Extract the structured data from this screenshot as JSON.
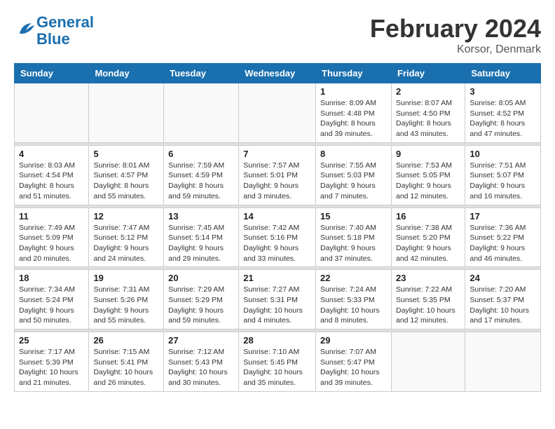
{
  "app": {
    "name": "GeneralBlue",
    "logo_text_part1": "General",
    "logo_text_part2": "Blue"
  },
  "header": {
    "month": "February 2024",
    "location": "Korsor, Denmark"
  },
  "weekdays": [
    "Sunday",
    "Monday",
    "Tuesday",
    "Wednesday",
    "Thursday",
    "Friday",
    "Saturday"
  ],
  "weeks": [
    [
      {
        "day": "",
        "info": ""
      },
      {
        "day": "",
        "info": ""
      },
      {
        "day": "",
        "info": ""
      },
      {
        "day": "",
        "info": ""
      },
      {
        "day": "1",
        "info": "Sunrise: 8:09 AM\nSunset: 4:48 PM\nDaylight: 8 hours\nand 39 minutes."
      },
      {
        "day": "2",
        "info": "Sunrise: 8:07 AM\nSunset: 4:50 PM\nDaylight: 8 hours\nand 43 minutes."
      },
      {
        "day": "3",
        "info": "Sunrise: 8:05 AM\nSunset: 4:52 PM\nDaylight: 8 hours\nand 47 minutes."
      }
    ],
    [
      {
        "day": "4",
        "info": "Sunrise: 8:03 AM\nSunset: 4:54 PM\nDaylight: 8 hours\nand 51 minutes."
      },
      {
        "day": "5",
        "info": "Sunrise: 8:01 AM\nSunset: 4:57 PM\nDaylight: 8 hours\nand 55 minutes."
      },
      {
        "day": "6",
        "info": "Sunrise: 7:59 AM\nSunset: 4:59 PM\nDaylight: 8 hours\nand 59 minutes."
      },
      {
        "day": "7",
        "info": "Sunrise: 7:57 AM\nSunset: 5:01 PM\nDaylight: 9 hours\nand 3 minutes."
      },
      {
        "day": "8",
        "info": "Sunrise: 7:55 AM\nSunset: 5:03 PM\nDaylight: 9 hours\nand 7 minutes."
      },
      {
        "day": "9",
        "info": "Sunrise: 7:53 AM\nSunset: 5:05 PM\nDaylight: 9 hours\nand 12 minutes."
      },
      {
        "day": "10",
        "info": "Sunrise: 7:51 AM\nSunset: 5:07 PM\nDaylight: 9 hours\nand 16 minutes."
      }
    ],
    [
      {
        "day": "11",
        "info": "Sunrise: 7:49 AM\nSunset: 5:09 PM\nDaylight: 9 hours\nand 20 minutes."
      },
      {
        "day": "12",
        "info": "Sunrise: 7:47 AM\nSunset: 5:12 PM\nDaylight: 9 hours\nand 24 minutes."
      },
      {
        "day": "13",
        "info": "Sunrise: 7:45 AM\nSunset: 5:14 PM\nDaylight: 9 hours\nand 29 minutes."
      },
      {
        "day": "14",
        "info": "Sunrise: 7:42 AM\nSunset: 5:16 PM\nDaylight: 9 hours\nand 33 minutes."
      },
      {
        "day": "15",
        "info": "Sunrise: 7:40 AM\nSunset: 5:18 PM\nDaylight: 9 hours\nand 37 minutes."
      },
      {
        "day": "16",
        "info": "Sunrise: 7:38 AM\nSunset: 5:20 PM\nDaylight: 9 hours\nand 42 minutes."
      },
      {
        "day": "17",
        "info": "Sunrise: 7:36 AM\nSunset: 5:22 PM\nDaylight: 9 hours\nand 46 minutes."
      }
    ],
    [
      {
        "day": "18",
        "info": "Sunrise: 7:34 AM\nSunset: 5:24 PM\nDaylight: 9 hours\nand 50 minutes."
      },
      {
        "day": "19",
        "info": "Sunrise: 7:31 AM\nSunset: 5:26 PM\nDaylight: 9 hours\nand 55 minutes."
      },
      {
        "day": "20",
        "info": "Sunrise: 7:29 AM\nSunset: 5:29 PM\nDaylight: 9 hours\nand 59 minutes."
      },
      {
        "day": "21",
        "info": "Sunrise: 7:27 AM\nSunset: 5:31 PM\nDaylight: 10 hours\nand 4 minutes."
      },
      {
        "day": "22",
        "info": "Sunrise: 7:24 AM\nSunset: 5:33 PM\nDaylight: 10 hours\nand 8 minutes."
      },
      {
        "day": "23",
        "info": "Sunrise: 7:22 AM\nSunset: 5:35 PM\nDaylight: 10 hours\nand 12 minutes."
      },
      {
        "day": "24",
        "info": "Sunrise: 7:20 AM\nSunset: 5:37 PM\nDaylight: 10 hours\nand 17 minutes."
      }
    ],
    [
      {
        "day": "25",
        "info": "Sunrise: 7:17 AM\nSunset: 5:39 PM\nDaylight: 10 hours\nand 21 minutes."
      },
      {
        "day": "26",
        "info": "Sunrise: 7:15 AM\nSunset: 5:41 PM\nDaylight: 10 hours\nand 26 minutes."
      },
      {
        "day": "27",
        "info": "Sunrise: 7:12 AM\nSunset: 5:43 PM\nDaylight: 10 hours\nand 30 minutes."
      },
      {
        "day": "28",
        "info": "Sunrise: 7:10 AM\nSunset: 5:45 PM\nDaylight: 10 hours\nand 35 minutes."
      },
      {
        "day": "29",
        "info": "Sunrise: 7:07 AM\nSunset: 5:47 PM\nDaylight: 10 hours\nand 39 minutes."
      },
      {
        "day": "",
        "info": ""
      },
      {
        "day": "",
        "info": ""
      }
    ]
  ]
}
